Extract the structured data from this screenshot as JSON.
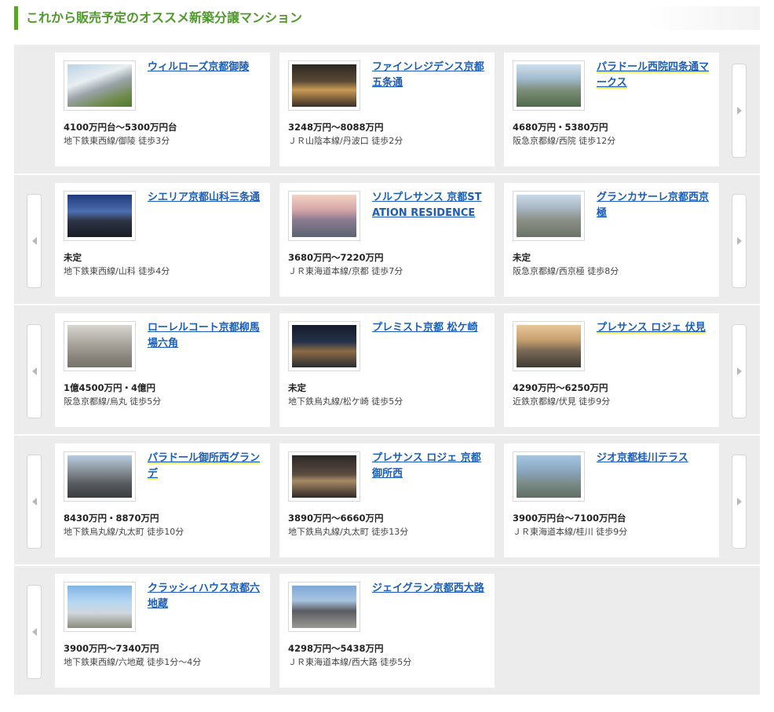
{
  "section": {
    "title": "これから販売予定のオススメ新築分譲マンション"
  },
  "colors": {
    "accent": "#5aa42a",
    "link": "#1a5dbb",
    "highlight": "#f3ec57",
    "row_bg": "#ececec"
  },
  "rows": [
    {
      "cards": [
        {
          "title": "ウィルローズ京都御陵",
          "price": "4100万円台～5300万円台",
          "access": "地下鉄東西線/御陵 徒歩3分",
          "highlight": false,
          "image": "building-photo"
        },
        {
          "title": "ファインレジデンス京都五条通",
          "price": "3248万円～8088万円",
          "access": "ＪＲ山陰本線/丹波口 徒歩2分",
          "highlight": false,
          "image": "night-entrance-photo"
        },
        {
          "title": "パラドール西院四条通マークス",
          "price": "4680万円・5380万円",
          "access": "阪急京都線/西院 徒歩12分",
          "highlight": true,
          "image": "aerial-photo"
        }
      ]
    },
    {
      "cards": [
        {
          "title": "シエリア京都山科三条通",
          "price": "未定",
          "access": "地下鉄東西線/山科 徒歩4分",
          "highlight": false,
          "image": "dusk-building-photo"
        },
        {
          "title": "ソルプレサンス 京都STATION RESIDENCE",
          "price": "3680万円～7220万円",
          "access": "ＪＲ東海道本線/京都 徒歩7分",
          "highlight": false,
          "image": "sunset-view-photo"
        },
        {
          "title": "グランカサーレ京都西京極",
          "price": "未定",
          "access": "阪急京都線/西京極 徒歩8分",
          "highlight": false,
          "image": "aerial-city-photo"
        }
      ]
    },
    {
      "cards": [
        {
          "title": "ローレルコート京都柳馬場六角",
          "price": "1億4500万円・4億円",
          "access": "阪急京都線/烏丸 徒歩5分",
          "highlight": false,
          "image": "map-aerial-photo"
        },
        {
          "title": "プレミスト京都 松ケ崎",
          "price": "未定",
          "access": "地下鉄烏丸線/松ケ崎 徒歩5分",
          "highlight": false,
          "image": "night-terrace-photo"
        },
        {
          "title": "プレサンス ロジェ 伏見",
          "price": "4290万円～6250万円",
          "access": "近鉄京都線/伏見 徒歩9分",
          "highlight": true,
          "image": "sunset-city-photo"
        }
      ]
    },
    {
      "cards": [
        {
          "title": "パラドール御所西グランデ",
          "price": "8430万円・8870万円",
          "access": "地下鉄烏丸線/丸太町 徒歩10分",
          "highlight": true,
          "image": "facade-photo"
        },
        {
          "title": "プレサンス ロジェ 京都御所西",
          "price": "3890万円～6660万円",
          "access": "地下鉄烏丸線/丸太町 徒歩13分",
          "highlight": false,
          "image": "lobby-photo"
        },
        {
          "title": "ジオ京都桂川テラス",
          "price": "3900万円台～7100万円台",
          "access": "ＪＲ東海道本線/桂川 徒歩9分",
          "highlight": false,
          "image": "aerial-blue-photo"
        }
      ]
    },
    {
      "cards": [
        {
          "title": "クラッシィハウス京都六地蔵",
          "price": "3900万円～7340万円",
          "access": "地下鉄東西線/六地蔵 徒歩1分～4分",
          "highlight": false,
          "image": "tower-sky-photo"
        },
        {
          "title": "ジェイグラン京都西大路",
          "price": "4298万円～5438万円",
          "access": "ＪＲ東海道本線/西大路 徒歩5分",
          "highlight": false,
          "image": "grey-building-photo"
        }
      ]
    }
  ]
}
